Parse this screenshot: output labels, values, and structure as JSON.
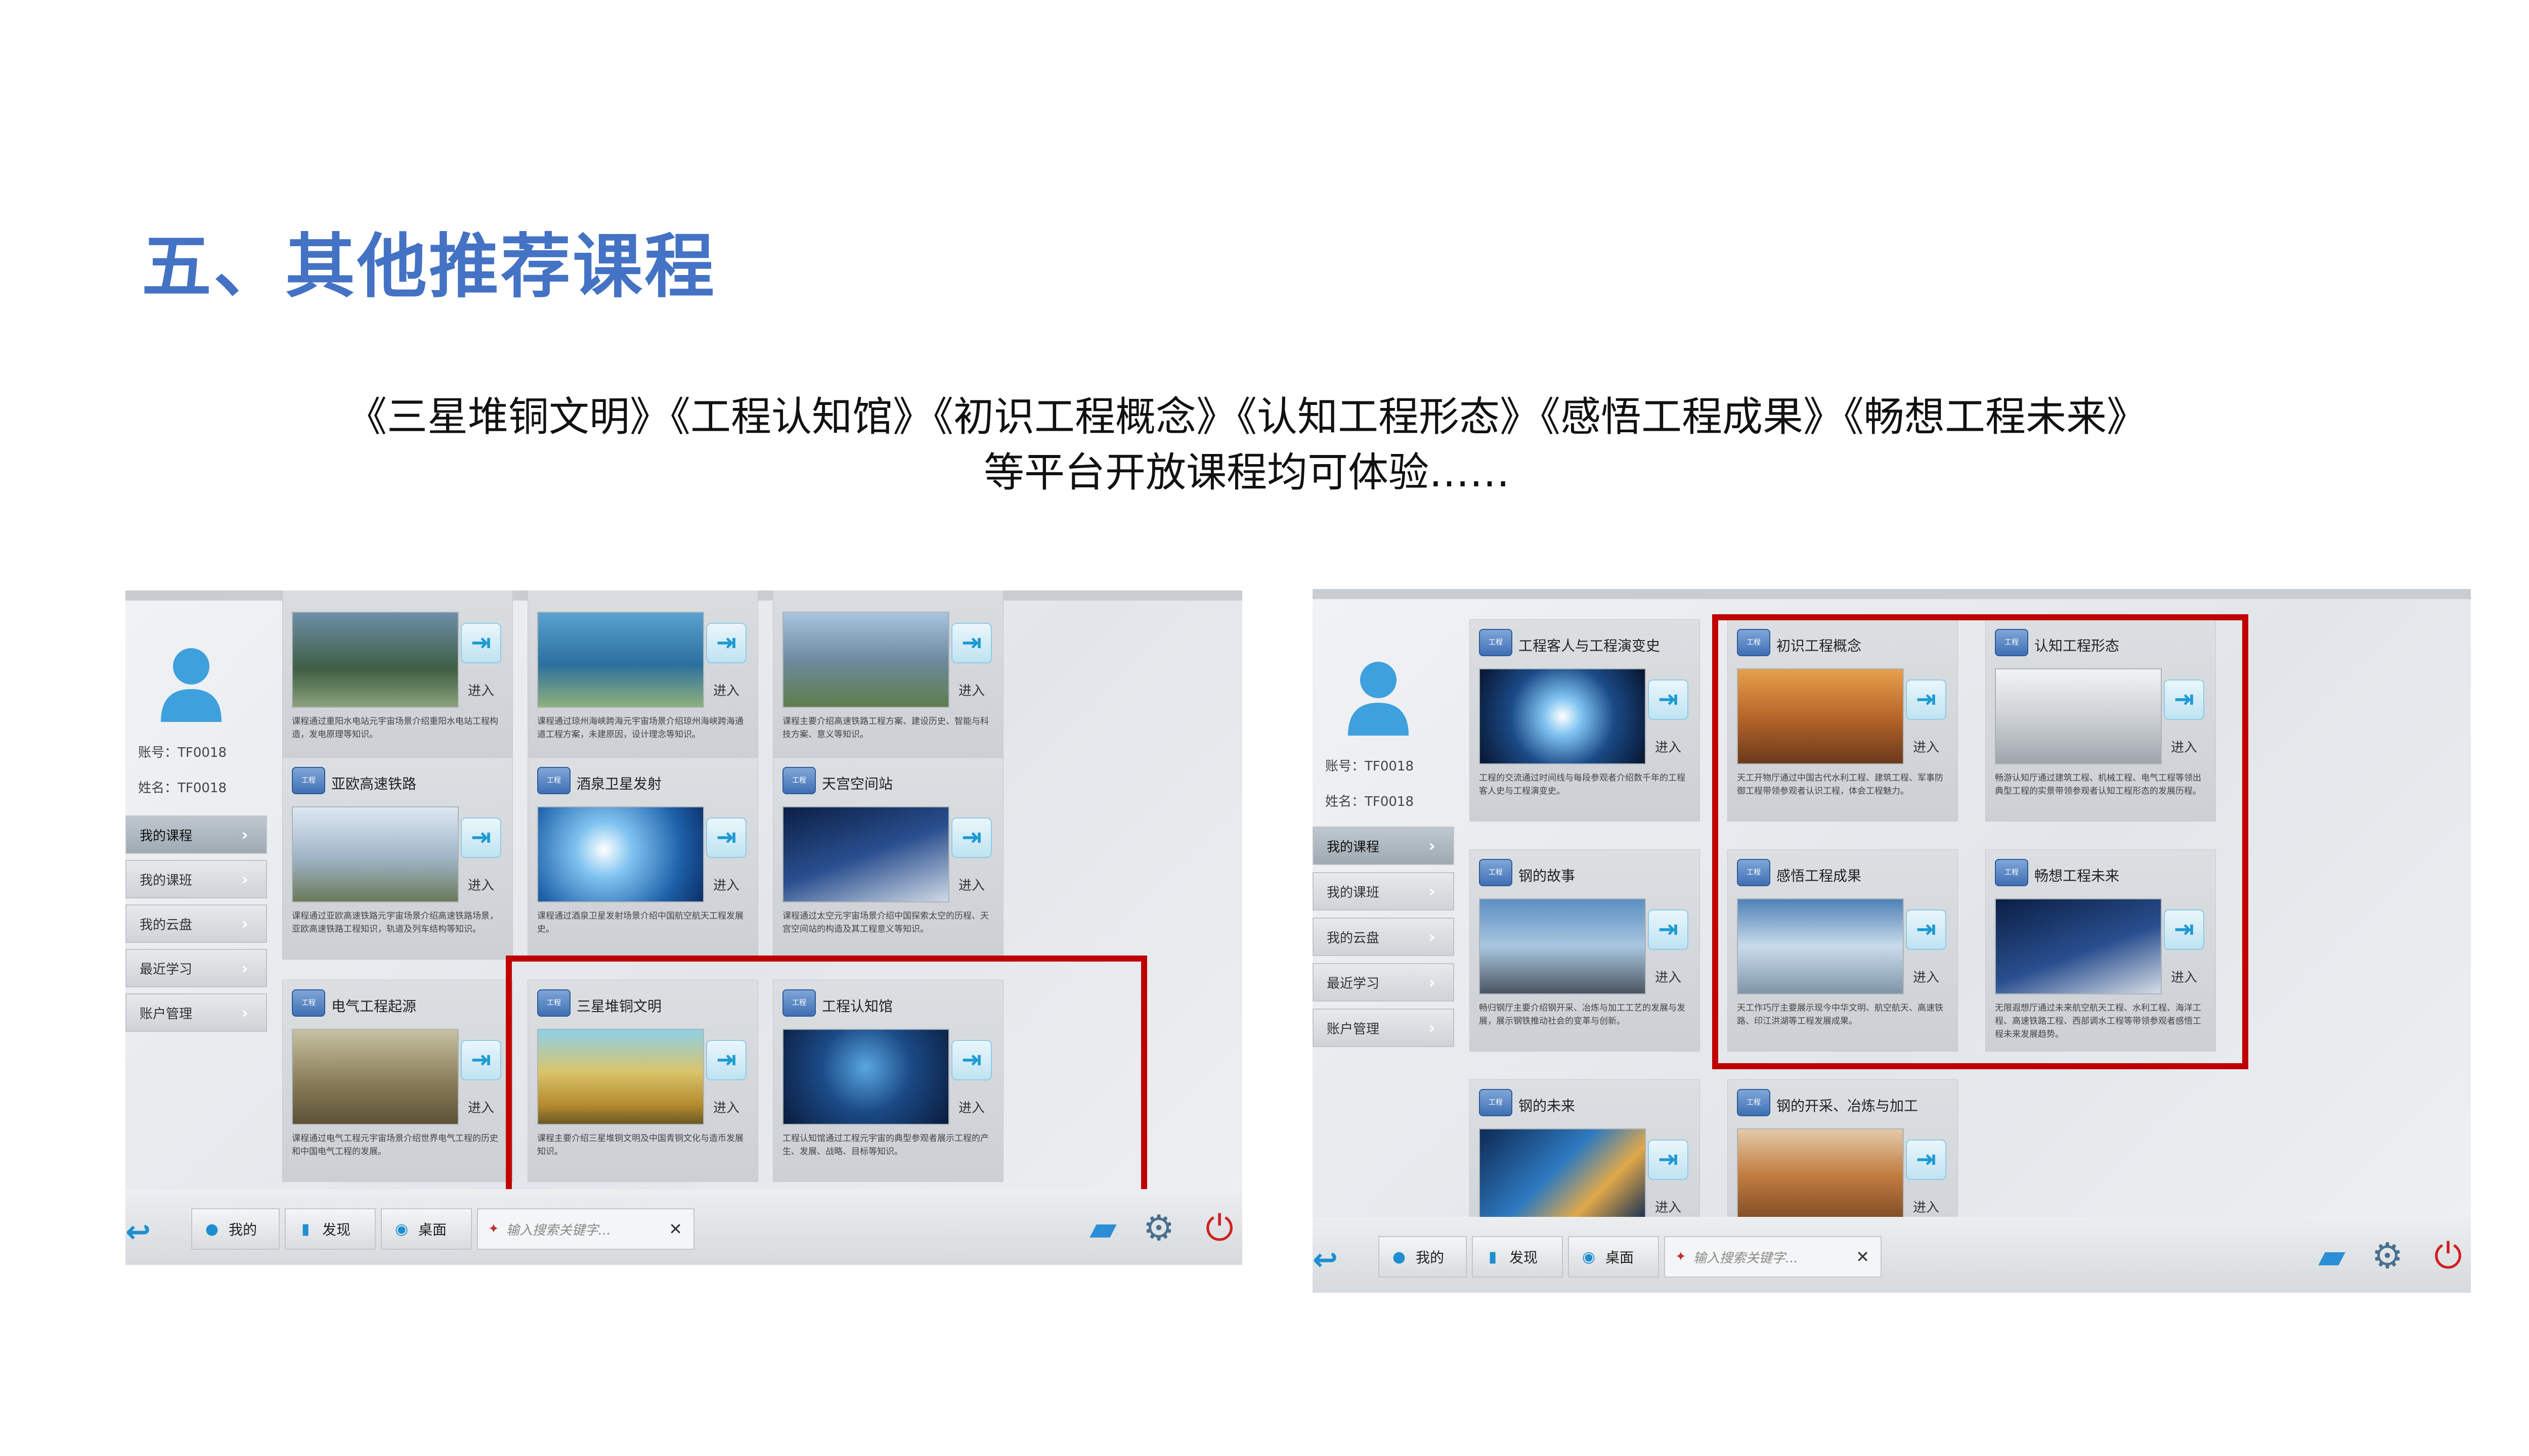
{
  "heading": "五、其他推荐课程",
  "subtitle_line1": "《三星堆铜文明》《工程认知馆》《初识工程概念》《认知工程形态》《感悟工程成果》《畅想工程未来》",
  "subtitle_line2": "等平台开放课程均可体验……",
  "colors": {
    "heading": "#4472c4",
    "highlight_box": "#c00000",
    "accent": "#1d8fd0"
  },
  "enter_label": "进入",
  "course_icon_text": "工程",
  "left_screenshot": {
    "account_label": "账号：TF0018",
    "name_label": "姓名：TF0018",
    "nav": [
      "我的课程",
      "我的课班",
      "我的云盘",
      "最近学习",
      "账户管理"
    ],
    "cards": [
      {
        "title": "",
        "desc": "课程通过重阳水电站元宇宙场景介绍重阳水电站工程构造，发电原理等知识。"
      },
      {
        "title": "",
        "desc": "课程通过琼州海峡跨海元宇宙场景介绍琼州海峡跨海通道工程方案，未建原因，设计理念等知识。"
      },
      {
        "title": "",
        "desc": "课程主要介绍高速铁路工程方案、建设历史、智能与科技方案、意义等知识。"
      },
      {
        "title": "亚欧高速铁路",
        "desc": "课程通过亚欧高速铁路元宇宙场景介绍高速铁路场景，亚欧高速铁路工程知识，轨道及列车结构等知识。"
      },
      {
        "title": "酒泉卫星发射",
        "desc": "课程通过酒泉卫星发射场景介绍中国航空航天工程发展史。"
      },
      {
        "title": "天宫空间站",
        "desc": "课程通过太空元宇宙场景介绍中国探索太空的历程、天宫空间站的构造及其工程意义等知识。"
      },
      {
        "title": "电气工程起源",
        "desc": "课程通过电气工程元宇宙场景介绍世界电气工程的历史和中国电气工程的发展。"
      },
      {
        "title": "三星堆铜文明",
        "desc": "课程主要介绍三星堆铜文明及中国青铜文化与造币发展知识。"
      },
      {
        "title": "工程认知馆",
        "desc": "工程认知馆通过工程元宇宙的典型参观者展示工程的产生、发展、战略、目标等知识。"
      }
    ],
    "tabs": [
      "我的",
      "发现",
      "桌面"
    ],
    "search_placeholder": "输入搜索关键字..."
  },
  "right_screenshot": {
    "account_label": "账号：TF0018",
    "name_label": "姓名：TF0018",
    "nav": [
      "我的课程",
      "我的课班",
      "我的云盘",
      "最近学习",
      "账户管理"
    ],
    "cards": [
      {
        "title": "工程客人与工程演变史",
        "desc": "工程的交流通过时间线与每段参观者介绍数千年的工程客人史与工程演变史。"
      },
      {
        "title": "初识工程概念",
        "desc": "天工开物厅通过中国古代水利工程、建筑工程、军事防御工程带领参观者认识工程，体会工程魅力。"
      },
      {
        "title": "认知工程形态",
        "desc": "畅游认知厅通过建筑工程、机械工程、电气工程等领出典型工程的实景带领参观者认知工程形态的发展历程。"
      },
      {
        "title": "钢的故事",
        "desc": "畅归钢厅主要介绍钢开采、冶炼与加工工艺的发展与发展，展示钢铁推动社会的变革与创新。"
      },
      {
        "title": "感悟工程成果",
        "desc": "天工作巧厅主要展示现今中华文明、航空航天、高速铁路、印江洪湖等工程发展成果。"
      },
      {
        "title": "畅想工程未来",
        "desc": "无限遐想厅通过未来航空航天工程、水利工程、海洋工程、高速铁路工程、西部调水工程等带领参观者感悟工程未来发展趋势。"
      },
      {
        "title": "钢的未来",
        "desc": ""
      },
      {
        "title": "钢的开采、冶炼与加工",
        "desc": ""
      }
    ],
    "tabs": [
      "我的",
      "发现",
      "桌面"
    ],
    "search_placeholder": "输入搜索关键字..."
  }
}
